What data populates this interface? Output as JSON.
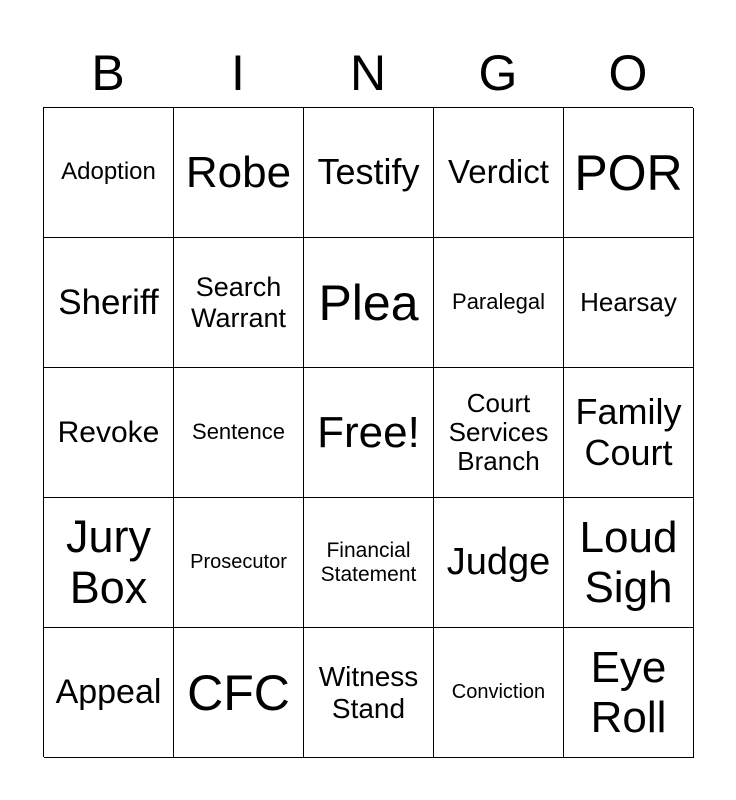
{
  "header": {
    "letters": [
      "B",
      "I",
      "N",
      "G",
      "O"
    ]
  },
  "cells": [
    [
      "Adoption",
      "Robe",
      "Testify",
      "Verdict",
      "POR"
    ],
    [
      "Sheriff",
      "Search\nWarrant",
      "Plea",
      "Paralegal",
      "Hearsay"
    ],
    [
      "Revoke",
      "Sentence",
      "Free!",
      "Court\nServices\nBranch",
      "Family\nCourt"
    ],
    [
      "Jury\nBox",
      "Prosecutor",
      "Financial\nStatement",
      "Judge",
      "Loud\nSigh"
    ],
    [
      "Appeal",
      "CFC",
      "Witness\nStand",
      "Conviction",
      "Eye\nRoll"
    ]
  ]
}
